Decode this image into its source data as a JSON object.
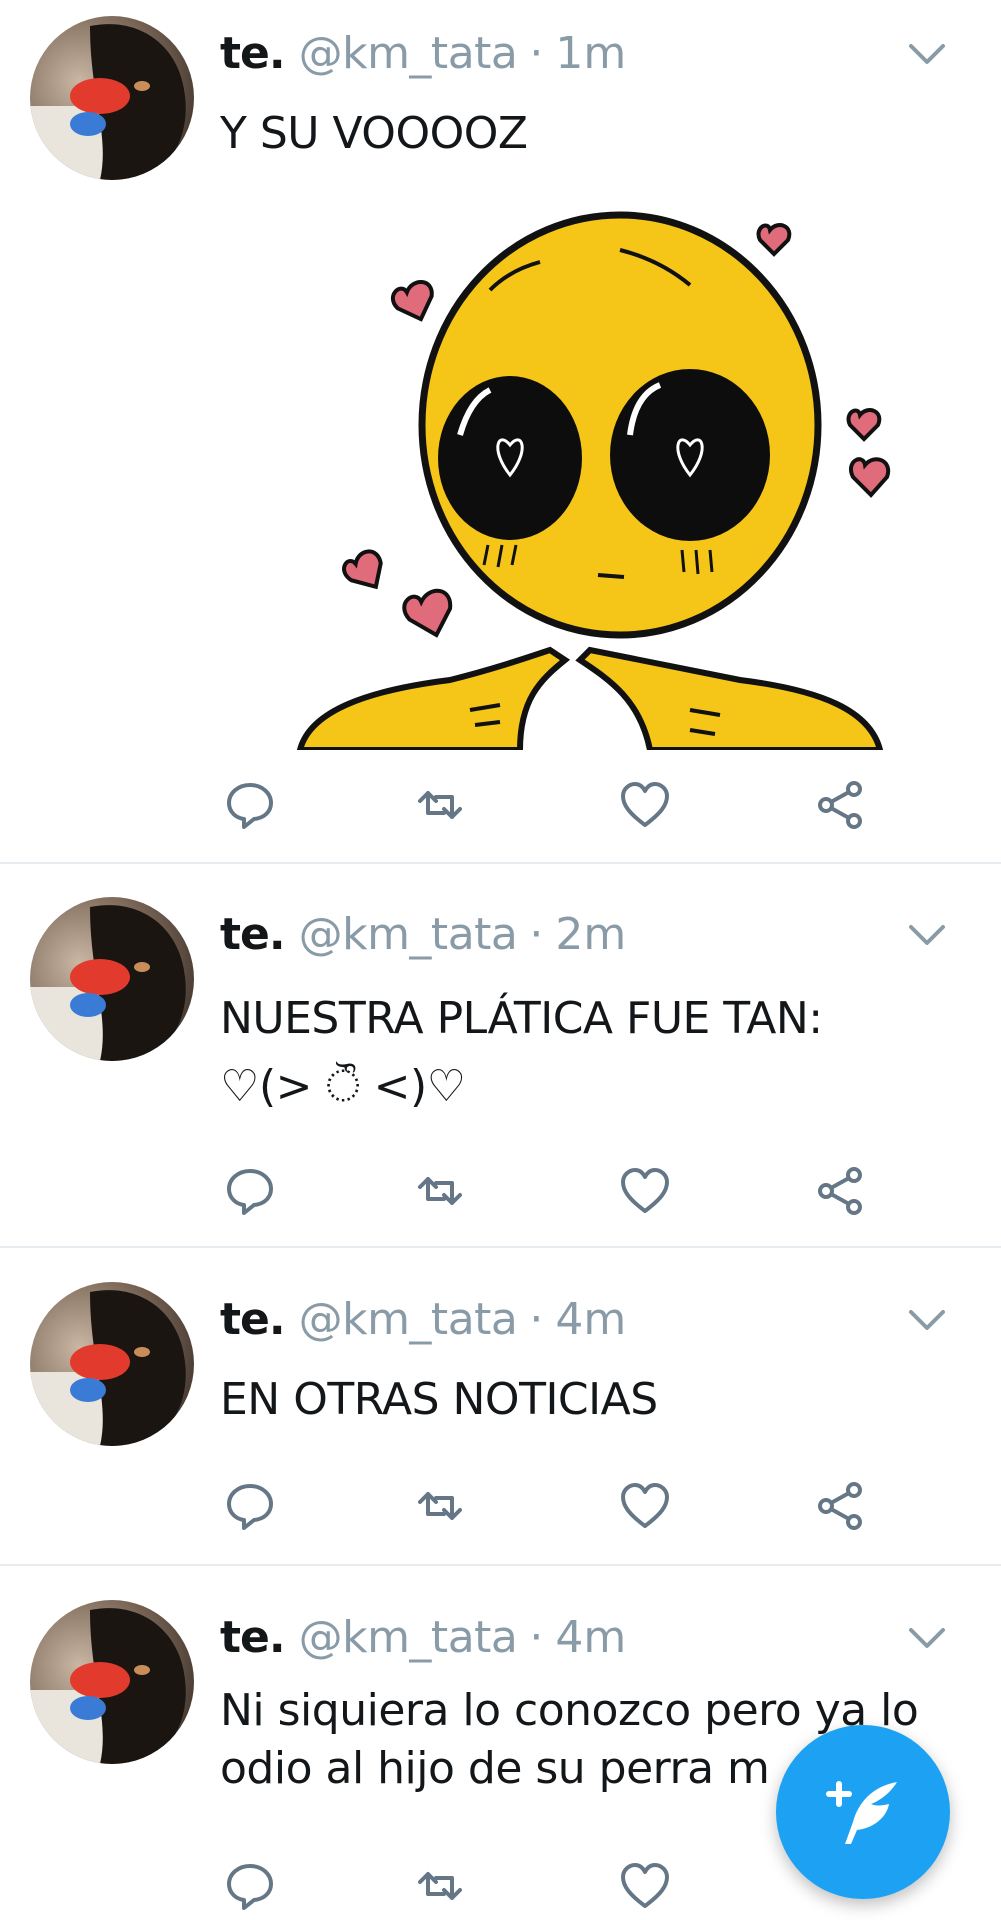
{
  "colors": {
    "accent": "#1da1f2",
    "muted": "#8a9ba8",
    "divider": "#e6ecf0"
  },
  "compose_button": {
    "icon": "compose-tweet-icon"
  },
  "tweets": [
    {
      "name": "te.",
      "handle": "@km_tata",
      "separator": "·",
      "time": "1m",
      "text": "Y SU VOOOOZ",
      "has_media": true,
      "media": {
        "description_icon": "cute-emoji-heart-eyes-image"
      }
    },
    {
      "name": "te.",
      "handle": "@km_tata",
      "separator": "·",
      "time": "2m",
      "text": "NUESTRA PLÁTICA FUE TAN:\n♡(> ੌ <)♡"
    },
    {
      "name": "te.",
      "handle": "@km_tata",
      "separator": "·",
      "time": "4m",
      "text": "EN OTRAS NOTICIAS"
    },
    {
      "name": "te.",
      "handle": "@km_tata",
      "separator": "·",
      "time": "4m",
      "text": "Ni siquiera lo conozco pero ya lo\nodio al hijo de su perra m"
    }
  ]
}
